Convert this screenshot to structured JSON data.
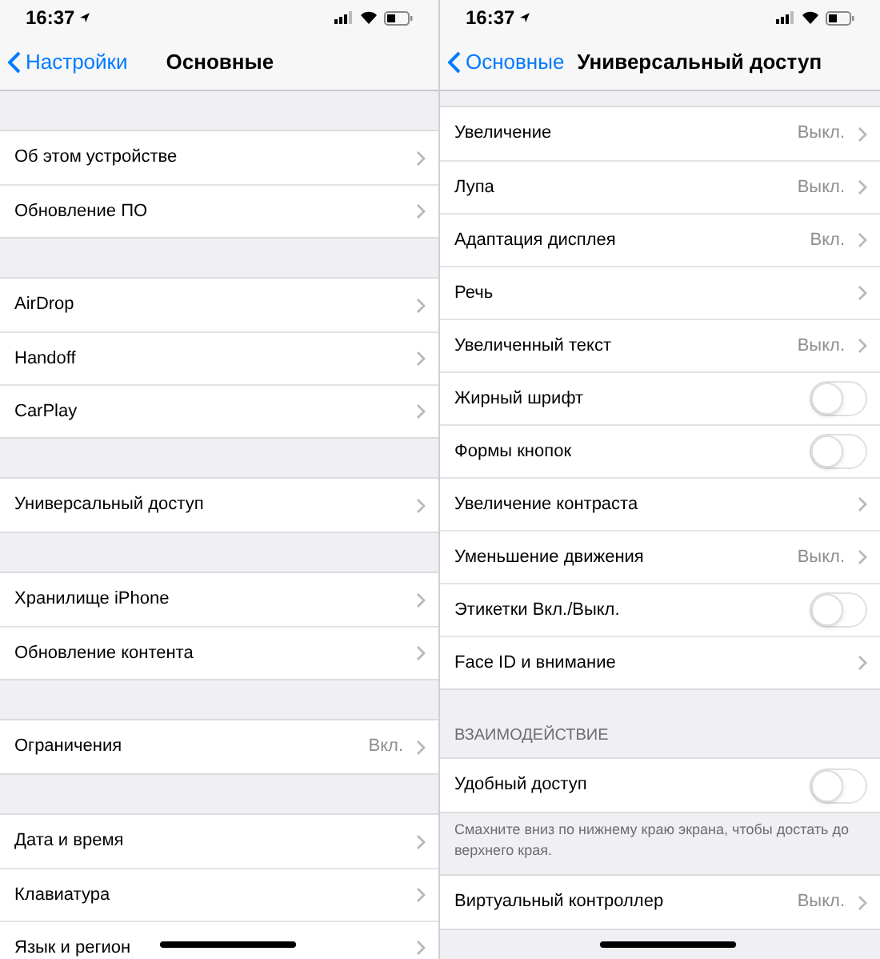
{
  "panes": [
    {
      "status_bar": {
        "time": "16:37"
      },
      "nav": {
        "back": "Настройки",
        "title": "Основные"
      },
      "sections": [
        {
          "items": [
            {
              "kind": "link",
              "label": "Об этом устройстве"
            },
            {
              "kind": "link",
              "label": "Обновление ПО"
            }
          ]
        },
        {
          "items": [
            {
              "kind": "link",
              "label": "AirDrop"
            },
            {
              "kind": "link",
              "label": "Handoff"
            },
            {
              "kind": "link",
              "label": "CarPlay"
            }
          ]
        },
        {
          "items": [
            {
              "kind": "link",
              "label": "Универсальный доступ"
            }
          ]
        },
        {
          "items": [
            {
              "kind": "link",
              "label": "Хранилище iPhone"
            },
            {
              "kind": "link",
              "label": "Обновление контента"
            }
          ]
        },
        {
          "items": [
            {
              "kind": "link",
              "label": "Ограничения",
              "value": "Вкл."
            }
          ]
        },
        {
          "items": [
            {
              "kind": "link",
              "label": "Дата и время"
            },
            {
              "kind": "link",
              "label": "Клавиатура"
            },
            {
              "kind": "link",
              "label": "Язык и регион"
            }
          ]
        }
      ]
    },
    {
      "status_bar": {
        "time": "16:37"
      },
      "nav": {
        "back": "Основные",
        "title": "Универсальный доступ"
      },
      "sections": [
        {
          "items": [
            {
              "kind": "link",
              "label": "Увеличение",
              "value": "Выкл."
            },
            {
              "kind": "link",
              "label": "Лупа",
              "value": "Выкл."
            },
            {
              "kind": "link",
              "label": "Адаптация дисплея",
              "value": "Вкл."
            },
            {
              "kind": "link",
              "label": "Речь"
            },
            {
              "kind": "link",
              "label": "Увеличенный текст",
              "value": "Выкл."
            },
            {
              "kind": "toggle",
              "label": "Жирный шрифт",
              "on": false
            },
            {
              "kind": "toggle",
              "label": "Формы кнопок",
              "on": false
            },
            {
              "kind": "link",
              "label": "Увеличение контраста"
            },
            {
              "kind": "link",
              "label": "Уменьшение движения",
              "value": "Выкл."
            },
            {
              "kind": "toggle",
              "label": "Этикетки Вкл./Выкл.",
              "on": false
            },
            {
              "kind": "link",
              "label": "Face ID и внимание"
            }
          ]
        },
        {
          "header": "ВЗАИМОДЕЙСТВИЕ",
          "items": [
            {
              "kind": "toggle",
              "label": "Удобный доступ",
              "on": false
            }
          ],
          "footer": "Смахните вниз по нижнему краю экрана, чтобы достать до верхнего края."
        },
        {
          "items": [
            {
              "kind": "link",
              "label": "Виртуальный контроллер",
              "value": "Выкл."
            }
          ]
        }
      ]
    }
  ]
}
